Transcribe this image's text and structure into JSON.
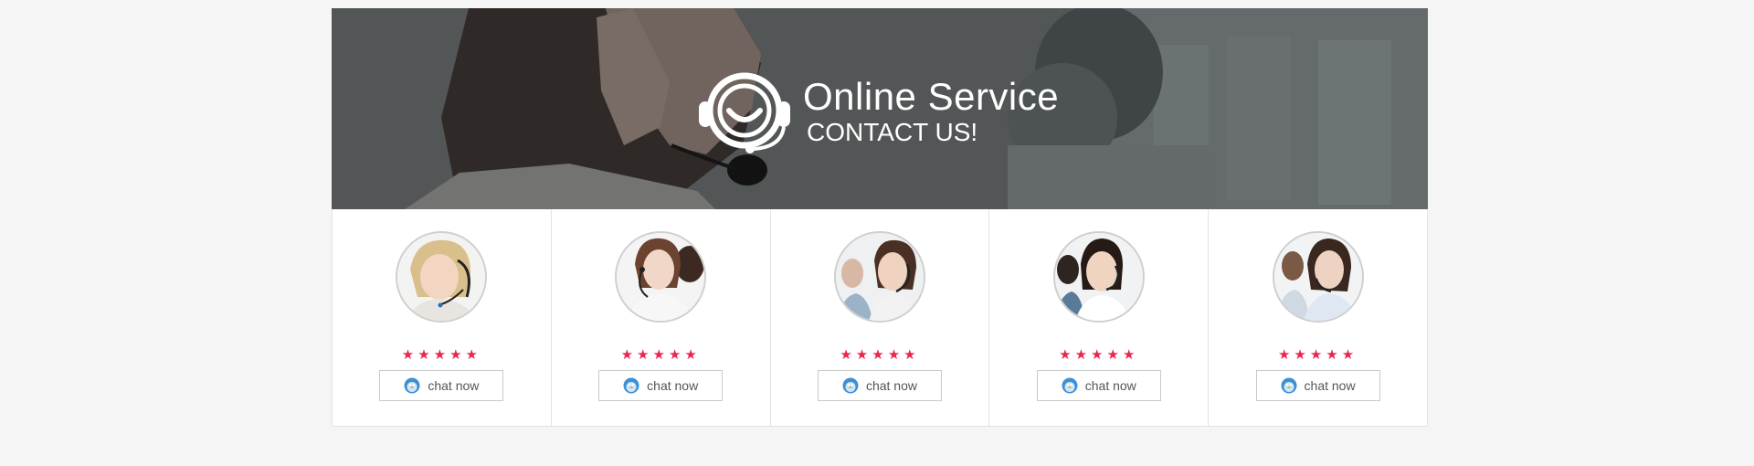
{
  "banner": {
    "title": "Online Service",
    "subtitle": "CONTACT US!",
    "icon": "headset-smile-icon"
  },
  "colors": {
    "star": "#e8284a",
    "border": "#e3e3e3",
    "button_text": "#555555"
  },
  "agents": [
    {
      "rating": 5,
      "stars": "★★★★★",
      "button_label": "chat now",
      "icon": "qq-penguin-icon"
    },
    {
      "rating": 5,
      "stars": "★★★★★",
      "button_label": "chat now",
      "icon": "qq-penguin-icon"
    },
    {
      "rating": 5,
      "stars": "★★★★★",
      "button_label": "chat now",
      "icon": "qq-penguin-icon"
    },
    {
      "rating": 5,
      "stars": "★★★★★",
      "button_label": "chat now",
      "icon": "qq-penguin-icon"
    },
    {
      "rating": 5,
      "stars": "★★★★★",
      "button_label": "chat now",
      "icon": "qq-penguin-icon"
    }
  ]
}
